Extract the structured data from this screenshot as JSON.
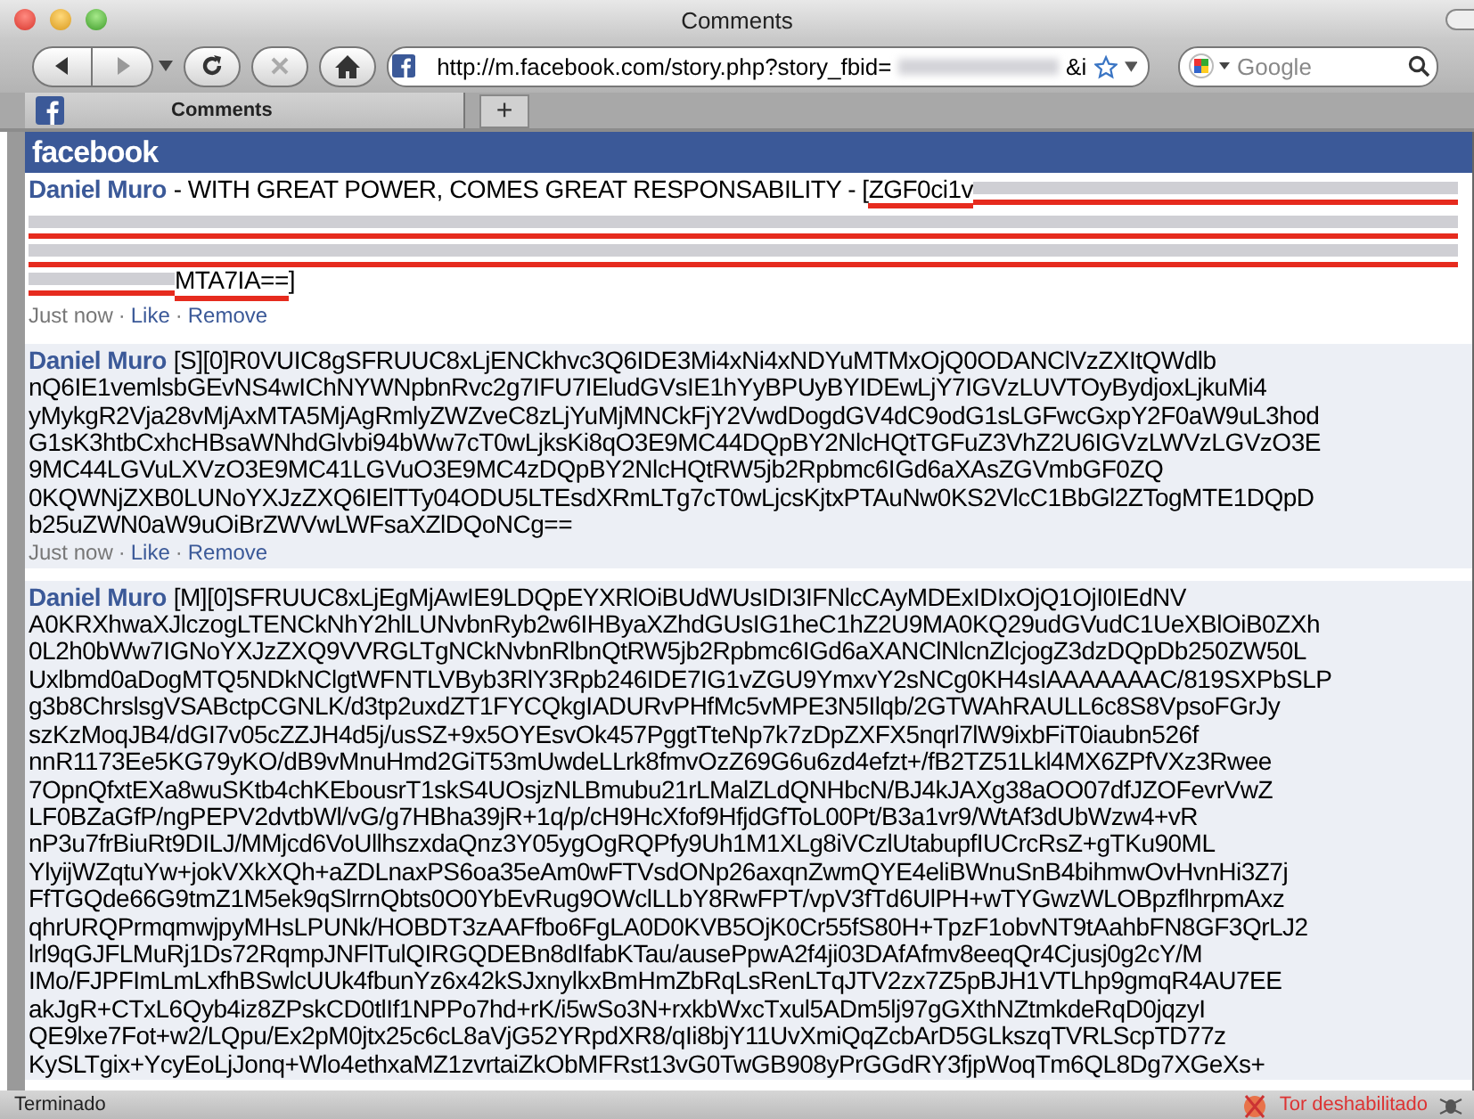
{
  "window": {
    "title": "Comments"
  },
  "toolbar": {
    "url": "http://m.facebook.com/story.php?story_fbid=",
    "url_tail": "&i",
    "search_placeholder": "Google"
  },
  "tabs": [
    {
      "label": "Comments",
      "selected": true
    }
  ],
  "new_tab": "+",
  "site": {
    "logo": "facebook"
  },
  "comments": [
    {
      "author": "Daniel Muro",
      "lines": [
        [
          {
            "kind": "text",
            "text": "- WITH GREAT POWER, COMES GREAT RESPONSABILITY - [",
            "underlined": false
          },
          {
            "kind": "text",
            "text": "ZGF0ci1v",
            "underlined": true
          },
          {
            "kind": "redacted",
            "underlined": true
          }
        ],
        [
          {
            "kind": "redacted",
            "underlined": true
          }
        ],
        [
          {
            "kind": "redacted",
            "underlined": true
          }
        ],
        [
          {
            "kind": "redacted-short",
            "underlined": true
          },
          {
            "kind": "text",
            "text": "MTA7IA==",
            "underlined": true
          },
          {
            "kind": "text",
            "text": "]",
            "underlined": false
          }
        ]
      ],
      "meta": [
        "Just now",
        "Like",
        "Remove"
      ],
      "separator": "·",
      "highlighted": false
    },
    {
      "author": "Daniel Muro",
      "lines": [
        [
          {
            "kind": "text",
            "text": "[S][0]R0VUIC8gSFRUUC8xLjENCkhvc3Q6IDE3Mi4xNi4xNDYuMTMxOjQ0ODANClVzZXItQWdlb",
            "underlined": false
          }
        ],
        [
          {
            "kind": "text",
            "text": "nQ6IE1vemlsbGEvNS4wIChNYWNpbnRvc2g7IFU7IEludGVsIE1hYyBPUyBYIDEwLjY7IGVzLUVTOyBydjoxLjkuMi4",
            "underlined": false
          }
        ],
        [
          {
            "kind": "text",
            "text": "yMykgR2Vja28vMjAxMTA5MjAgRmlyZWZveC8zLjYuMjMNCkFjY2VwdDogdGV4dC9odG1sLGFwcGxpY2F0aW9uL3hod",
            "underlined": false
          }
        ],
        [
          {
            "kind": "text",
            "text": "G1sK3htbCxhcHBsaWNhdGlvbi94bWw7cT0wLjksKi8qO3E9MC44DQpBY2NlcHQtTGFuZ3VhZ2U6IGVzLWVzLGVzO3E",
            "underlined": false
          }
        ],
        [
          {
            "kind": "text",
            "text": "9MC44LGVuLXVzO3E9MC41LGVuO3E9MC4zDQpBY2NlcHQtRW5jb2Rpbmc6IGd6aXAsZGVmbGF0ZQ",
            "underlined": false
          }
        ],
        [
          {
            "kind": "text",
            "text": "0KQWNjZXB0LUNoYXJzZXQ6IElTTy04ODU5LTEsdXRmLTg7cT0wLjcsKjtxPTAuNw0KS2VlcC1BbGl2ZTogMTE1DQpD",
            "underlined": false
          }
        ],
        [
          {
            "kind": "text",
            "text": "b25uZWN0aW9uOiBrZWVwLWFsaXZlDQoNCg==",
            "underlined": false
          }
        ]
      ],
      "meta": [
        "Just now",
        "Like",
        "Remove"
      ],
      "separator": "·",
      "highlighted": true
    },
    {
      "author": "Daniel Muro",
      "lines": [
        [
          {
            "kind": "text",
            "text": "[M][0]SFRUUC8xLjEgMjAwIE9LDQpEYXRlOiBUdWUsIDI3IFNlcCAyMDExIDIxOjQ1OjI0IEdNV",
            "underlined": false
          }
        ],
        [
          {
            "kind": "text",
            "text": "A0KRXhwaXJlczogLTENCkNhY2hlLUNvbnRyb2w6IHByaXZhdGUsIG1heC1hZ2U9MA0KQ29udGVudC1UeXBlOiB0ZXh",
            "underlined": false
          }
        ],
        [
          {
            "kind": "text",
            "text": "0L2h0bWw7IGNoYXJzZXQ9VVRGLTgNCkNvbnRlbnQtRW5jb2Rpbmc6IGd6aXANClNlcnZlcjogZ3dzDQpDb250ZW50L",
            "underlined": false
          }
        ],
        [
          {
            "kind": "text",
            "text": "Uxlbmd0aDogMTQ5NDkNClgtWFNTLVByb3RlY3Rpb246IDE7IG1vZGU9YmxvY2sNCg0KH4sIAAAAAAAC/819SXPbSLP",
            "underlined": false
          }
        ],
        [
          {
            "kind": "text",
            "text": "g3b8ChrslsgVSABctpCGNLK/d3tp2uxdZT1FYCQkgIADURvPHfMc5vMPE3N5Ilqb/2GTWAhRAULL6c8S8VpsoFGrJy",
            "underlined": false
          }
        ],
        [
          {
            "kind": "text",
            "text": "szKzMoqJB4/dGI7v05cZZJH4d5j/usSZ+9x5OYEsvOk457PggtTteNp7k7zDpZXFX5nqrl7lW9ixbFiT0iaubn526f",
            "underlined": false
          }
        ],
        [
          {
            "kind": "text",
            "text": "nnR1173Ee5KG79yKO/dB9vMnuHmd2GiT53mUwdeLLrk8fmvOzZ69G6u6zd4efzt+/fB2TZ51Lkl4MX6ZPfVXz3Rwee",
            "underlined": false
          }
        ],
        [
          {
            "kind": "text",
            "text": "7OpnQfxtEXa8wuSKtb4chKEbousrT1skS4UOsjzNLBmubu21rLMalZLdQNHbcN/BJ4kJAXg38aOO07dfJZOFevrVwZ",
            "underlined": false
          }
        ],
        [
          {
            "kind": "text",
            "text": "LF0BZaGfP/ngPEPV2dvtbWl/vG/g7HBha39jR+1q/p/cH9HcXfof9HfjdGfToL00Pt/B3a1vr9/WtAf3dUbWzw4+vR",
            "underlined": false
          }
        ],
        [
          {
            "kind": "text",
            "text": "nP3u7frBiuRt9DILJ/MMjcd6VoUllhszxdaQnz3Y05ygOgRQPfy9Uh1M1XLg8iVCzlUtabupfIUCrcRsZ+gTKu90ML",
            "underlined": false
          }
        ],
        [
          {
            "kind": "text",
            "text": "YlyijWZqtuYw+jokVXkXQh+aZDLnaxPS6oa35eAm0wFTVsdONp26axqnZwmQYE4eliBWnuSnB4bihmwOvHvnHi3Z7j",
            "underlined": false
          }
        ],
        [
          {
            "kind": "text",
            "text": "FfTGQde66G9tmZ1M5ek9qSlrrnQbts0O0YbEvRug9OWclLLbY8RwFPT/vpV3fTd6UlPH+wTYGwzWLOBpzflhrpmAxz",
            "underlined": false
          }
        ],
        [
          {
            "kind": "text",
            "text": "qhrURQPrmqmwjpyMHsLPUNk/HOBDT3zAAFfbo6FgLA0D0KVB5OjK0Cr55fS80H+TpzF1obvNT9tAahbFN8GF3QrLJ2",
            "underlined": false
          }
        ],
        [
          {
            "kind": "text",
            "text": "lrl9qGJFLMuRj1Ds72RqmpJNFlTulQIRGQDEBn8dIfabKTau/ausePpwA2f4ji03DAfAfmv8eeqQr4Cjusj0g2cY/M",
            "underlined": false
          }
        ],
        [
          {
            "kind": "text",
            "text": "IMo/FJPFImLmLxfhBSwlcUUk4fbunYz6x42kSJxnylkxBmHmZbRqLsRenLTqJTV2zx7Z5pBJH1VTLhp9gmqR4AU7EE",
            "underlined": false
          }
        ],
        [
          {
            "kind": "text",
            "text": "akJgR+CTxL6Qyb4iz8ZPskCD0tlIf1NPPo7hd+rK/i5wSo3N+rxkbWxcTxul5ADm5lj97gGXthNZtmkdeRqD0jqzyI",
            "underlined": false
          }
        ],
        [
          {
            "kind": "text",
            "text": "QE9lxe7Fot+w2/LQpu/Ex2pM0jtx25c6cL8aVjG52YRpdXR8/qIi8bjY11UvXmiQqZcbArD5GLkszqTVRLScpTD77z",
            "underlined": false
          }
        ],
        [
          {
            "kind": "text",
            "text": "KySLTgix+YcyEoLjJonq+Wlo4ethxaMZ1zvrtaiZkObMFRst13vG0TwGB908yPrGGdRY3fjpWoqTm6QL8Dg7XGeXs+",
            "underlined": false
          }
        ]
      ],
      "highlighted": true
    }
  ],
  "status_bar": {
    "text": "Terminado",
    "tor": "Tor deshabilitado"
  }
}
